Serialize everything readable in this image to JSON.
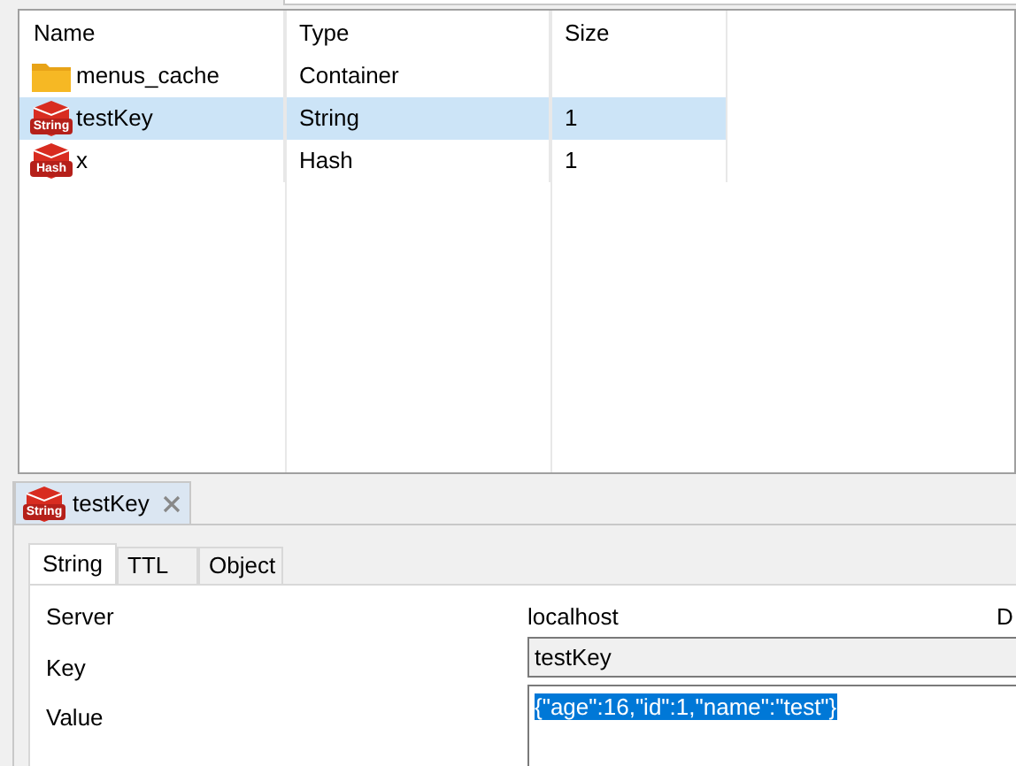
{
  "table": {
    "columns": [
      "Name",
      "Type",
      "Size"
    ],
    "rows": [
      {
        "kind": "folder",
        "name": "menus_cache",
        "type": "Container",
        "size": "",
        "selected": false
      },
      {
        "kind": "key",
        "badge": "String",
        "name": "testKey",
        "type": "String",
        "size": "1",
        "selected": true
      },
      {
        "kind": "key",
        "badge": "Hash",
        "name": "x",
        "type": "Hash",
        "size": "1",
        "selected": false
      }
    ]
  },
  "editor_tab": {
    "badge": "String",
    "title": "testKey"
  },
  "subtabs": [
    {
      "label": "String",
      "selected": true
    },
    {
      "label": "TTL",
      "selected": false
    },
    {
      "label": "Object",
      "selected": false
    }
  ],
  "form": {
    "server_label": "Server",
    "server": "localhost",
    "column_4": "D",
    "key_label": "Key",
    "key": "testKey",
    "value_label": "Value",
    "value": "{\"age\":16,\"id\":1,\"name\":\"test\"}"
  }
}
